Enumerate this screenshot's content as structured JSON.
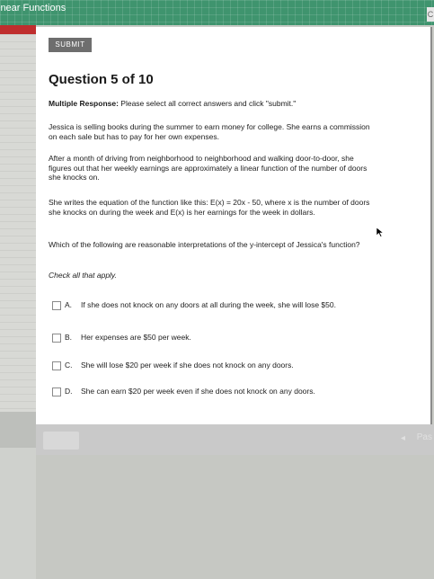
{
  "window": {
    "title": "inear Functions"
  },
  "toolbar": {
    "submit_label": "SUBMIT"
  },
  "question": {
    "title": "Question 5 of 10",
    "instruction_lead": "Multiple Response:",
    "instruction_text": " Please select all correct answers and click \"submit.\"",
    "paragraphs": [
      "Jessica is selling books during the summer to earn money for college. She earns a commission on each sale but has to pay for her own expenses.",
      "After a month of driving from neighborhood to neighborhood and walking door-to-door, she figures out that her weekly earnings are approximately a linear function of the number of doors she knocks on.",
      "She writes the equation of the function like this: E(x) = 20x - 50, where x is the number of doors she knocks on during the week and E(x) is her earnings for the week in dollars.",
      "Which of the following are reasonable interpretations of the y-intercept of Jessica's function?"
    ],
    "check_all": "Check all that apply.",
    "options": [
      {
        "letter": "A.",
        "text": "If she does not knock on any doors at all during the week, she will lose $50."
      },
      {
        "letter": "B.",
        "text": "Her expenses are $50 per week."
      },
      {
        "letter": "C.",
        "text": "She will lose $20 per week if she does not knock on any doors."
      },
      {
        "letter": "D.",
        "text": "She can earn $20 per week even if she does not knock on any doors."
      }
    ]
  },
  "footer": {
    "arrow": "◂",
    "pass_label": "Pas"
  },
  "colors": {
    "accent": "#3f946e",
    "header_red": "#bf2e2e"
  },
  "icons": {
    "cursor": "arrow-cursor-icon"
  }
}
